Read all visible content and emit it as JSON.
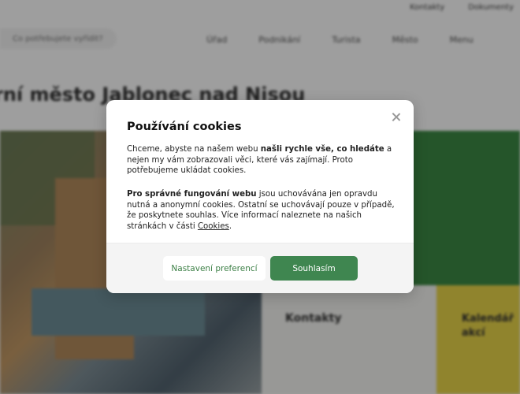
{
  "background": {
    "top_links": [
      "Kontakty",
      "Dokumenty"
    ],
    "search_placeholder": "Co potřebujete vyřídit?",
    "nav": [
      "Úřad",
      "Podnikání",
      "Turista",
      "Město",
      "Menu"
    ],
    "heading": "rní město Jablonec nad Nisou",
    "contacts_label": "Kontakty",
    "calendar_label": "Kalendář akcí"
  },
  "dialog": {
    "title": "Používání cookies",
    "p1_a": "Chceme, abyste na našem webu ",
    "p1_b": "našli rychle vše, co hledáte",
    "p1_c": " a nejen my vám zobrazovali věci, které vás zajímají. Proto potřebujeme ukládat cookies.",
    "p2_a": "Pro správné fungování webu",
    "p2_b": " jsou uchovávána jen opravdu nutná a anonymní cookies. Ostatní se uchovávají pouze v případě, že poskytnete souhlas. Více informací naleznete na našich stránkách v části ",
    "p2_link": "Cookies",
    "p2_end": ".",
    "btn_preferences": "Nastavení preferencí",
    "btn_agree": "Souhlasím"
  },
  "colors": {
    "accent_green": "#3f8650",
    "panel_green": "#3d8a45",
    "panel_yellow": "#e9d54a"
  }
}
